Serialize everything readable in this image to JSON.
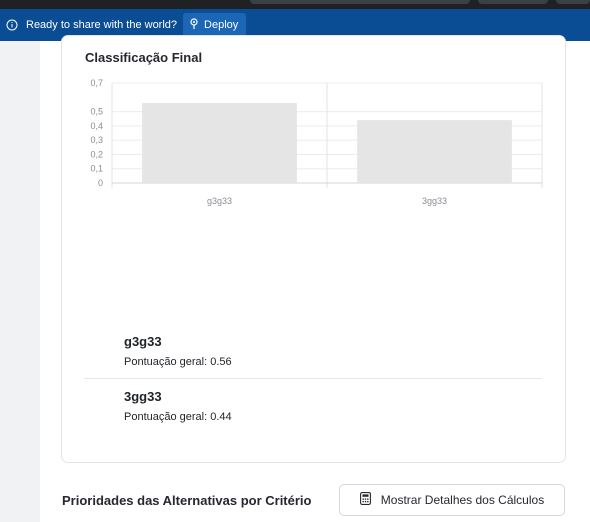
{
  "banner": {
    "message": "Ready to share with the world?",
    "deploy_label": "Deploy"
  },
  "card": {
    "title": "Classificação Final"
  },
  "chart_data": {
    "type": "bar",
    "categories": [
      "g3g33",
      "3gg33"
    ],
    "values": [
      0.56,
      0.44
    ],
    "ytick_labels": [
      "0,7",
      "0,5",
      "0,4",
      "0,3",
      "0,2",
      "0,1",
      "0"
    ],
    "ylim": [
      0,
      0.7
    ],
    "grid": true,
    "bar_color": "#e5e5e5"
  },
  "alternatives": [
    {
      "name": "g3g33",
      "score_label": "Pontuação geral: 0.56"
    },
    {
      "name": "3gg33",
      "score_label": "Pontuação geral: 0.44"
    }
  ],
  "section": {
    "title": "Prioridades das Alternativas por Critério",
    "details_button_label": "Mostrar Detalhes dos Cálculos"
  },
  "colors": {
    "banner_bg": "#0b4d95",
    "deploy_bg": "#1c66b6",
    "bar": "#e5e5e5"
  }
}
